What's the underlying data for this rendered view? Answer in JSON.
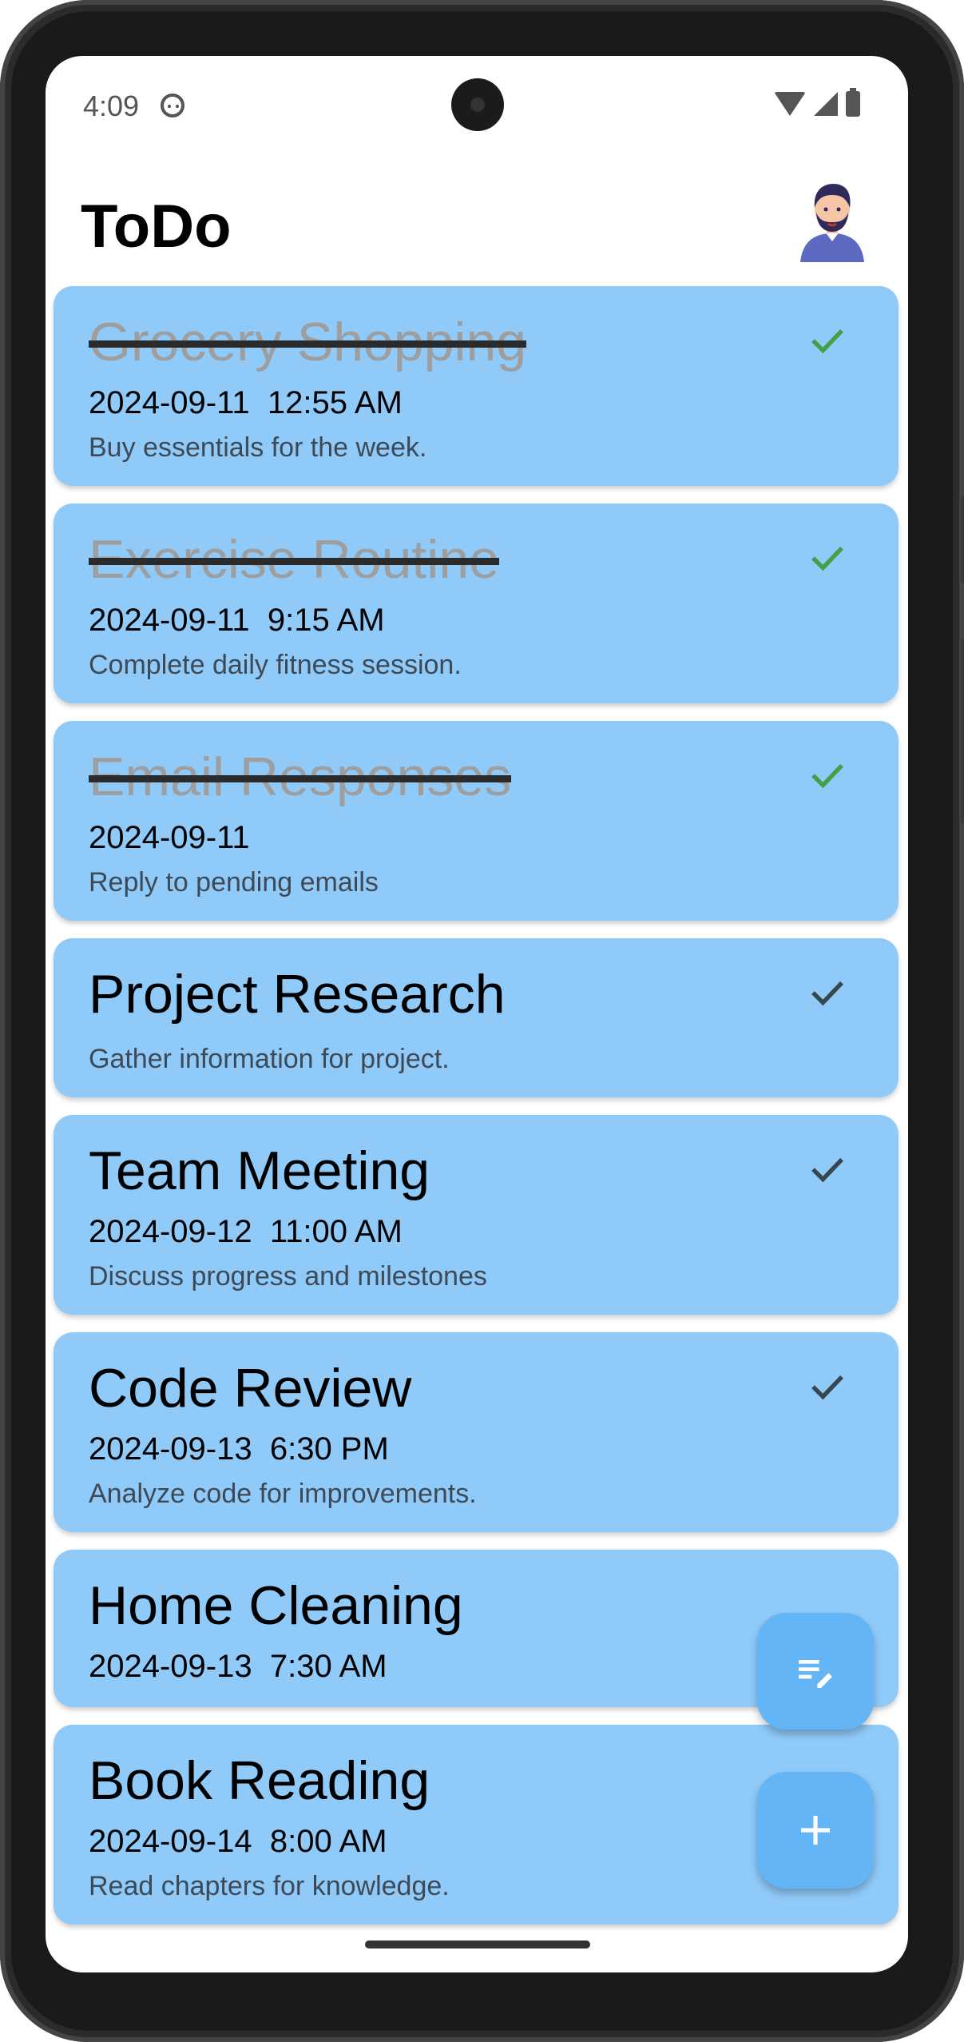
{
  "status_bar": {
    "time": "4:09"
  },
  "app_bar": {
    "title": "ToDo"
  },
  "tasks": [
    {
      "title": "Grocery Shopping",
      "date": "2024-09-11  12:55 AM",
      "description": "Buy essentials for the week.",
      "completed": true
    },
    {
      "title": "Exercise Routine",
      "date": "2024-09-11  9:15 AM",
      "description": "Complete daily fitness session.",
      "completed": true
    },
    {
      "title": "Email Responses",
      "date": "2024-09-11",
      "description": "Reply to pending emails",
      "completed": true
    },
    {
      "title": "Project Research",
      "date": "",
      "description": "Gather information for project.",
      "completed": false
    },
    {
      "title": "Team Meeting",
      "date": "2024-09-12  11:00 AM",
      "description": "Discuss progress and milestones",
      "completed": false
    },
    {
      "title": "Code Review",
      "date": "2024-09-13  6:30 PM",
      "description": "Analyze code for improvements.",
      "completed": false
    },
    {
      "title": "Home Cleaning",
      "date": "2024-09-13  7:30 AM",
      "description": "",
      "completed": false
    },
    {
      "title": "Book Reading",
      "date": "2024-09-14  8:00 AM",
      "description": "Read chapters for knowledge.",
      "completed": false
    }
  ],
  "colors": {
    "card": "#90caf9",
    "fab": "#64b5f6",
    "check_done": "#43a047",
    "check_pending": "#37474f"
  },
  "fabs": {
    "edit_icon": "edit-note-icon",
    "add_icon": "add-icon"
  }
}
